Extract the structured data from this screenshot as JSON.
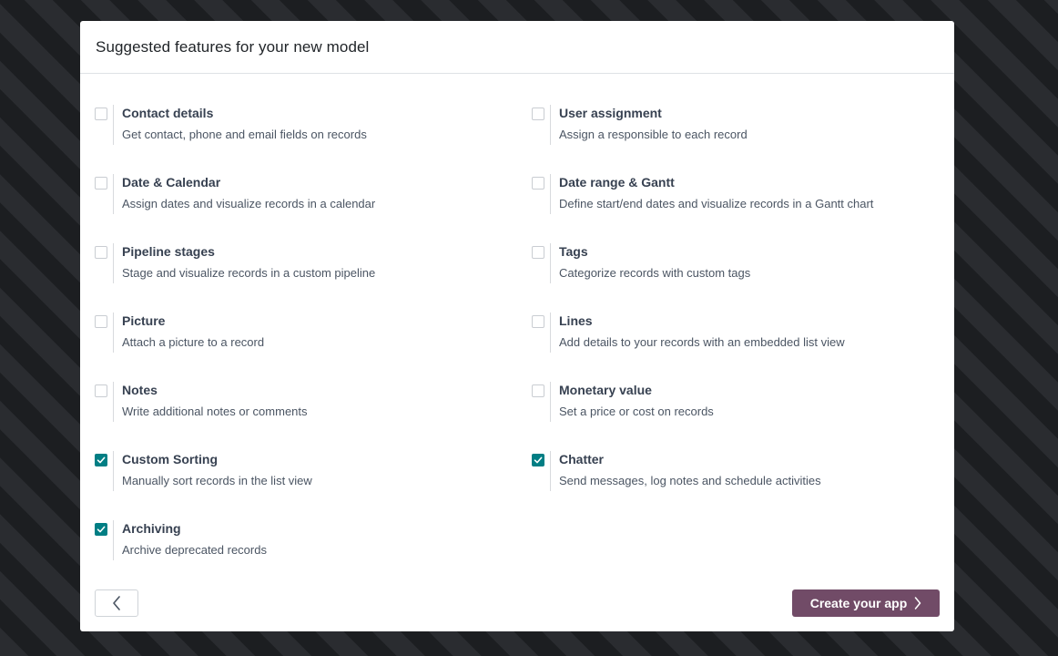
{
  "dialog": {
    "title": "Suggested features for your new model"
  },
  "features": [
    {
      "title": "Contact details",
      "description": "Get contact, phone and email fields on records",
      "checked": false
    },
    {
      "title": "User assignment",
      "description": "Assign a responsible to each record",
      "checked": false
    },
    {
      "title": "Date & Calendar",
      "description": "Assign dates and visualize records in a calendar",
      "checked": false
    },
    {
      "title": "Date range & Gantt",
      "description": "Define start/end dates and visualize records in a Gantt chart",
      "checked": false
    },
    {
      "title": "Pipeline stages",
      "description": "Stage and visualize records in a custom pipeline",
      "checked": false
    },
    {
      "title": "Tags",
      "description": "Categorize records with custom tags",
      "checked": false
    },
    {
      "title": "Picture",
      "description": "Attach a picture to a record",
      "checked": false
    },
    {
      "title": "Lines",
      "description": "Add details to your records with an embedded list view",
      "checked": false
    },
    {
      "title": "Notes",
      "description": "Write additional notes or comments",
      "checked": false
    },
    {
      "title": "Monetary value",
      "description": "Set a price or cost on records",
      "checked": false
    },
    {
      "title": "Custom Sorting",
      "description": "Manually sort records in the list view",
      "checked": true
    },
    {
      "title": "Chatter",
      "description": "Send messages, log notes and schedule activities",
      "checked": true
    },
    {
      "title": "Archiving",
      "description": "Archive deprecated records",
      "checked": true
    }
  ],
  "footer": {
    "back_icon": "chevron-left-icon",
    "create_label": "Create your app",
    "create_icon": "chevron-right-icon"
  },
  "colors": {
    "accent": "#714b67",
    "checkbox_checked": "#017e84"
  }
}
